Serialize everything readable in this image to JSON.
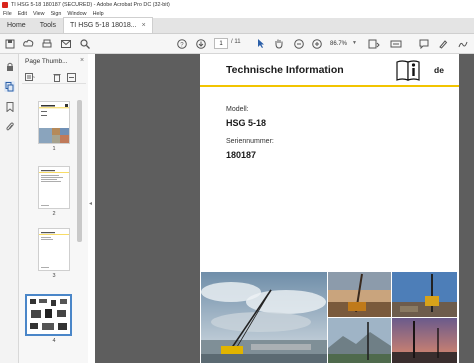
{
  "window": {
    "title": "TI HSG 5-18 180187 (SECURED) - Adobe Acrobat Pro DC (32-bit)"
  },
  "menu": [
    "File",
    "Edit",
    "View",
    "Sign",
    "Window",
    "Help"
  ],
  "tabs": {
    "home": "Home",
    "tools": "Tools",
    "document": "TI HSG 5-18 18018...",
    "close": "×"
  },
  "toolbar": {
    "page_current": "1",
    "page_total": "/ 11",
    "zoom": "86.7%"
  },
  "panel": {
    "title": "Page Thumb...",
    "close": "×",
    "thumbnails": [
      {
        "number": "1",
        "selected": false
      },
      {
        "number": "2",
        "selected": false
      },
      {
        "number": "3",
        "selected": false
      },
      {
        "number": "4",
        "selected": true
      }
    ]
  },
  "document": {
    "heading": "Technische Information",
    "language": "de",
    "model_label": "Modell:",
    "model_value": "HSG 5-18",
    "serial_label": "Seriennummer:",
    "serial_value": "180187"
  },
  "colors": {
    "accent_yellow": "#f2c400",
    "selection_blue": "#4a86c8",
    "doc_background": "#5e5e5e"
  }
}
